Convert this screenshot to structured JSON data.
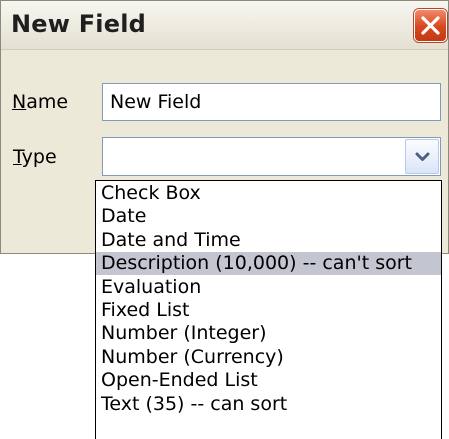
{
  "dialog": {
    "title": "New Field",
    "close_icon": "close-icon"
  },
  "form": {
    "name_label_mnemonic": "N",
    "name_label_rest": "ame",
    "name_value": "New Field",
    "type_label_mnemonic": "T",
    "type_label_rest": "ype",
    "type_value": ""
  },
  "dropdown": {
    "highlighted_index": 3,
    "options": [
      "Check Box",
      "Date",
      "Date and Time",
      "Description (10,000) -- can't sort",
      "Evaluation",
      "Fixed List",
      "Number (Integer)",
      "Number (Currency)",
      "Open-Ended List",
      "Text (35) -- can sort"
    ]
  },
  "colors": {
    "close_button": "#d6471f",
    "highlight": "#c3c6d1",
    "input_border": "#7f9db9"
  }
}
